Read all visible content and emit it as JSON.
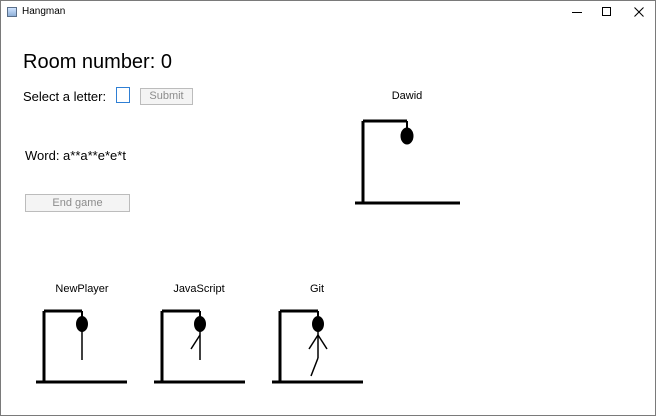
{
  "window": {
    "title": "Hangman",
    "app_icon": "window-app-icon",
    "controls": [
      "minimize-icon",
      "maximize-icon",
      "close-icon"
    ]
  },
  "room": {
    "label": "Room number: 0"
  },
  "letter_selection": {
    "label": "Select a letter:",
    "value": "",
    "submit_label": "Submit"
  },
  "word": {
    "label": "Word: a**a**e*e*t"
  },
  "end_game": {
    "label": "End game"
  },
  "players": [
    {
      "name": "Dawid",
      "stage": "head"
    },
    {
      "name": "NewPlayer",
      "stage": "head-body"
    },
    {
      "name": "JavaScript",
      "stage": "head-body-left-arm"
    },
    {
      "name": "Git",
      "stage": "head-body-arms-left-leg"
    }
  ]
}
